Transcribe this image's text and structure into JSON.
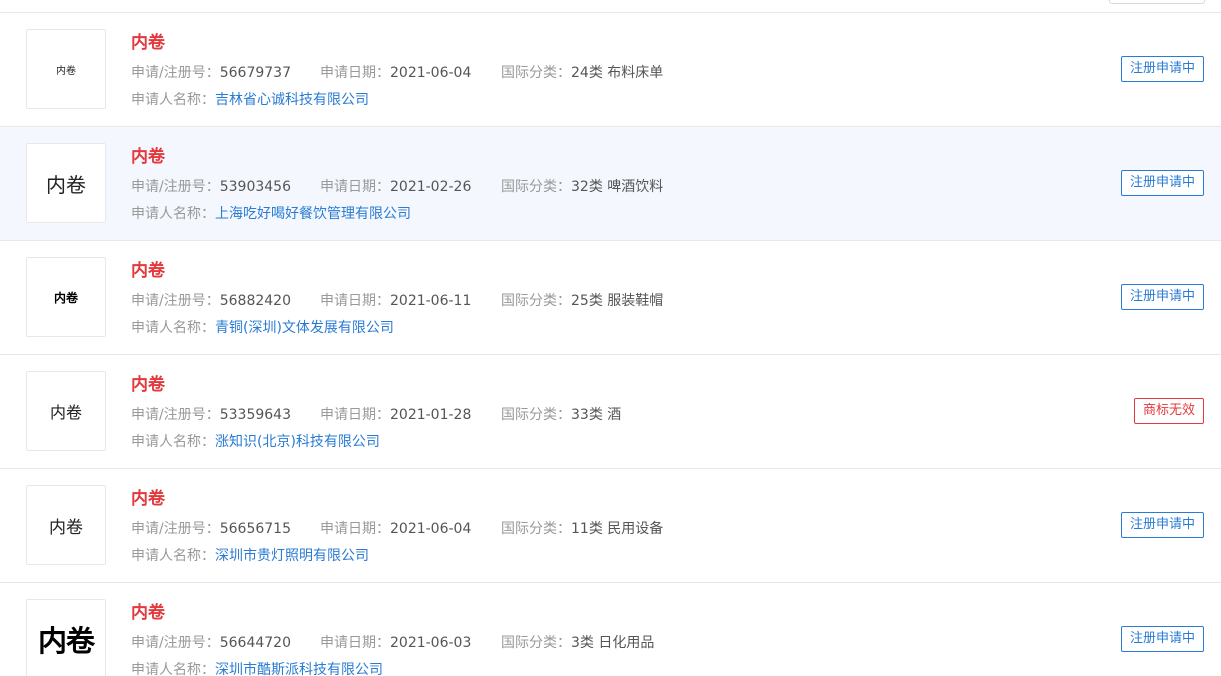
{
  "labels": {
    "reg_no": "申请/注册号：",
    "apply_date": "申请日期：",
    "intl_class": "国际分类：",
    "applicant": "申请人名称："
  },
  "records": [
    {
      "logo_text": "内卷",
      "name": "内卷",
      "reg_no": "56679737",
      "apply_date": "2021-06-04",
      "intl_class": "24类 布料床单",
      "applicant": "吉林省心诚科技有限公司",
      "status": "注册申请中",
      "status_kind": "pending",
      "highlighted": false,
      "logo_style": "s1"
    },
    {
      "logo_text": "内卷",
      "name": "内卷",
      "reg_no": "53903456",
      "apply_date": "2021-02-26",
      "intl_class": "32类 啤酒饮料",
      "applicant": "上海吃好喝好餐饮管理有限公司",
      "status": "注册申请中",
      "status_kind": "pending",
      "highlighted": true,
      "logo_style": "s2"
    },
    {
      "logo_text": "内卷",
      "name": "内卷",
      "reg_no": "56882420",
      "apply_date": "2021-06-11",
      "intl_class": "25类 服装鞋帽",
      "applicant": "青铜(深圳)文体发展有限公司",
      "status": "注册申请中",
      "status_kind": "pending",
      "highlighted": false,
      "logo_style": "s3"
    },
    {
      "logo_text": "内卷",
      "name": "内卷",
      "reg_no": "53359643",
      "apply_date": "2021-01-28",
      "intl_class": "33类 酒",
      "applicant": "涨知识(北京)科技有限公司",
      "status": "商标无效",
      "status_kind": "invalid",
      "highlighted": false,
      "logo_style": "s4"
    },
    {
      "logo_text": "内卷",
      "name": "内卷",
      "reg_no": "56656715",
      "apply_date": "2021-06-04",
      "intl_class": "11类 民用设备",
      "applicant": "深圳市贵灯照明有限公司",
      "status": "注册申请中",
      "status_kind": "pending",
      "highlighted": false,
      "logo_style": "s5"
    },
    {
      "logo_text": "内卷",
      "name": "内卷",
      "reg_no": "56644720",
      "apply_date": "2021-06-03",
      "intl_class": "3类 日化用品",
      "applicant": "深圳市酷斯派科技有限公司",
      "status": "注册申请中",
      "status_kind": "pending",
      "highlighted": false,
      "logo_style": "s6"
    }
  ],
  "colors": {
    "title_red": "#e4393c",
    "link_blue": "#2a7bd3",
    "pending_blue": "#2a7bd3",
    "invalid_red": "#e4393c",
    "highlight_bg": "#f4f8fe"
  }
}
